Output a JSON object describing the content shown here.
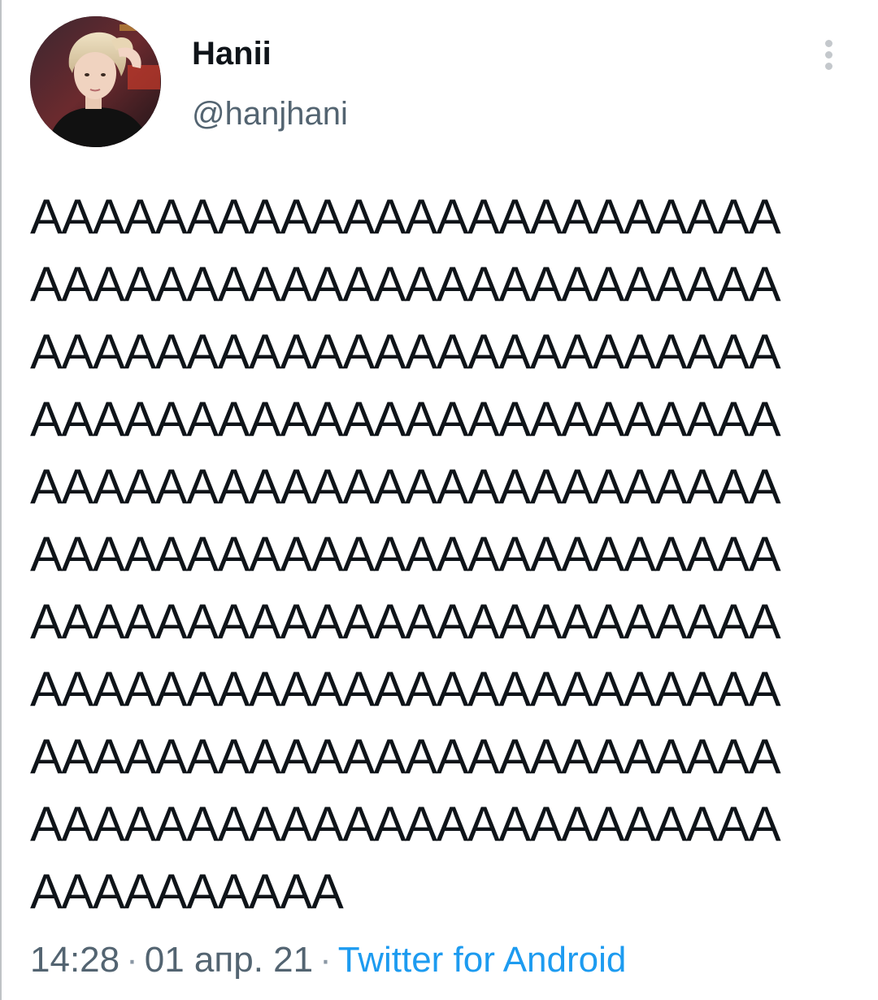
{
  "tweet": {
    "display_name": "Hanii",
    "handle": "@hanjhani",
    "text": "AAAAAAAAAAAAAAAAAAAAAAAA\nAAAAAAAAAAAAAAAAAAAAAAAA\nAAAAAAAAAAAAAAAAAAAAAAAA\nAAAAAAAAAAAAAAAAAAAAAAAA\nAAAAAAAAAAAAAAAAAAAAAAAA\nAAAAAAAAAAAAAAAAAAAAAAAA\nAAAAAAAAAAAAAAAAAAAAAAAA\nAAAAAAAAAAAAAAAAAAAAAAAA\nAAAAAAAAAAAAAAAAAAAAAAAA\nAAAAAAAAAAAAAAAAAAAAAAAA\nAAAAAAAAAA",
    "time": "14:28",
    "separator": "·",
    "date": "01 апр. 21",
    "source": "Twitter for Android",
    "more_icon": "more-vertical-icon"
  },
  "colors": {
    "text": "#0f1419",
    "secondary": "#536471",
    "link": "#1d9bf0",
    "background": "#ffffff"
  }
}
